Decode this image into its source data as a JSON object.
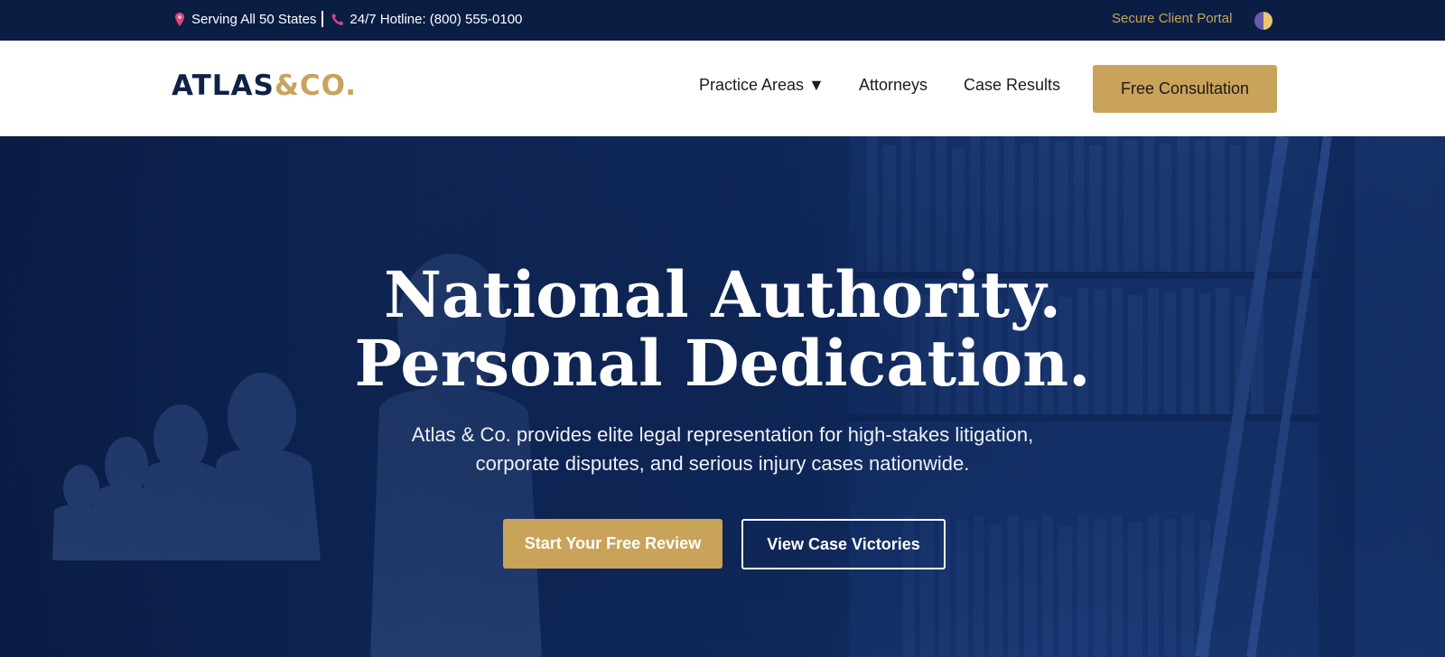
{
  "topbar": {
    "location_icon": "map-pin-icon",
    "location_text": "Serving All 50 States",
    "phone_icon": "phone-icon",
    "hotline_text": "24/7 Hotline: (800) 555-0100",
    "portal_label": "Secure Client Portal",
    "theme_toggle_icon": "half-moon-theme-icon"
  },
  "header": {
    "logo_main": "ATLAS",
    "logo_accent": "&CO.",
    "nav": {
      "practice_areas": "Practice Areas ▼",
      "attorneys": "Attorneys",
      "case_results": "Case Results"
    },
    "cta_label": "Free Consultation"
  },
  "hero": {
    "title_line1": "National Authority.",
    "title_line2": "Personal Dedication.",
    "subtitle_line1": "Atlas & Co. provides elite legal representation for high-stakes litigation,",
    "subtitle_line2": "corporate disputes, and serious injury cases nationwide.",
    "primary_cta": "Start Your Free Review",
    "secondary_cta": "View Case Victories"
  },
  "colors": {
    "navy": "#0a1e44",
    "gold": "#c9a35a",
    "white": "#ffffff"
  }
}
